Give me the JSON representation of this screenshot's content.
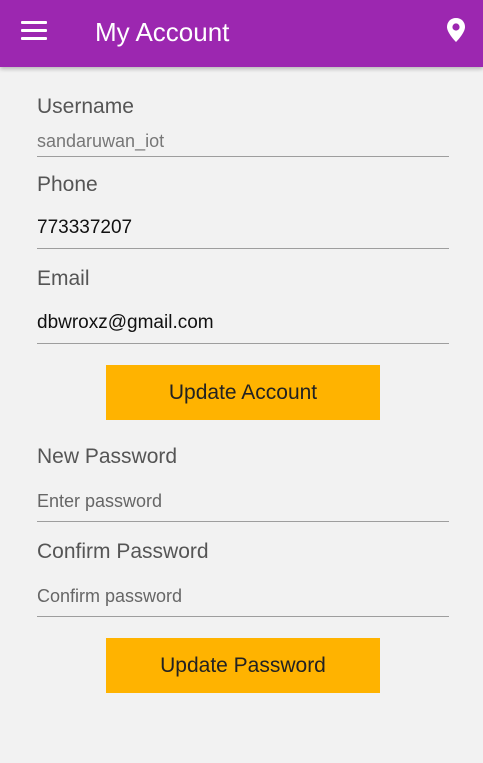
{
  "app_bar": {
    "title": "My Account",
    "background": "#9c27b0",
    "menu_icon": "hamburger-menu-icon",
    "location_icon": "map-pin-icon"
  },
  "account": {
    "username_label": "Username",
    "username_value": "sandaruwan_iot",
    "phone_label": "Phone",
    "phone_value": "773337207",
    "email_label": "Email",
    "email_value": "dbwroxz@gmail.com",
    "update_button": "Update Account"
  },
  "password": {
    "new_label": "New Password",
    "new_placeholder": "Enter password",
    "confirm_label": "Confirm Password",
    "confirm_placeholder": "Confirm password",
    "update_button": "Update Password"
  },
  "colors": {
    "accent": "#ffb300",
    "primary": "#9c27b0"
  }
}
